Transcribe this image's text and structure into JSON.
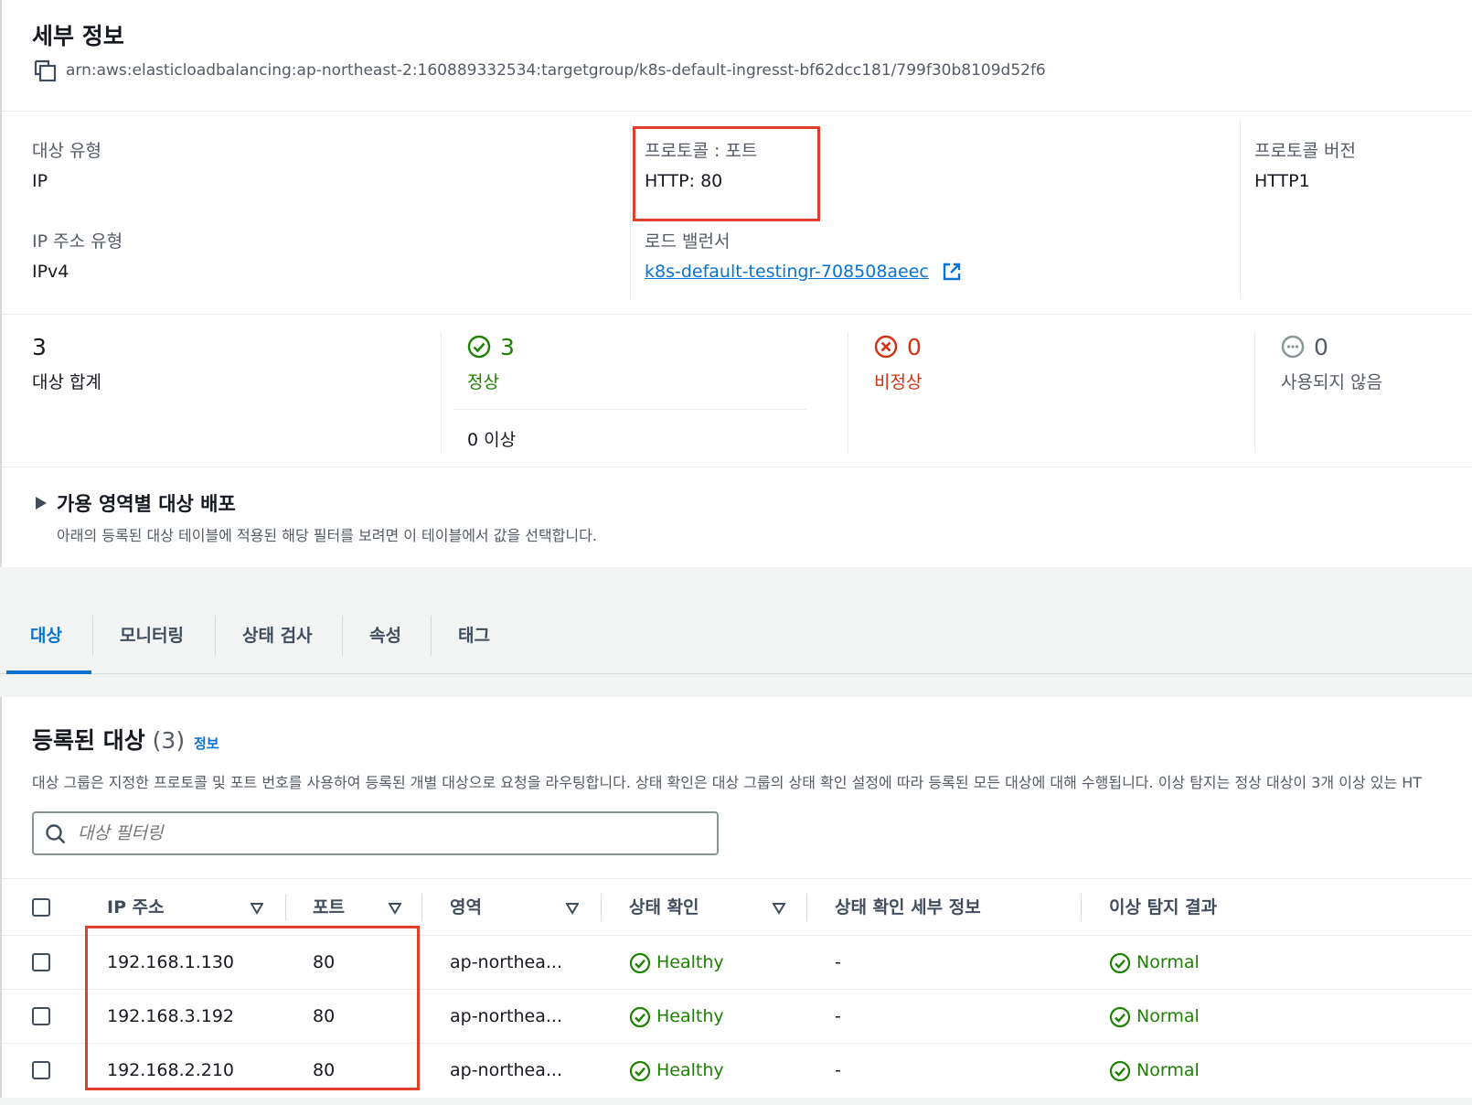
{
  "details": {
    "title": "세부 정보",
    "arn": "arn:aws:elasticloadbalancing:ap-northeast-2:160889332534:targetgroup/k8s-default-ingresst-bf62dcc181/799f30b8109d52f6",
    "target_type_label": "대상 유형",
    "target_type_value": "IP",
    "ip_type_label": "IP 주소 유형",
    "ip_type_value": "IPv4",
    "protocol_port_label": "프로토콜 : 포트",
    "protocol_port_value": "HTTP: 80",
    "load_balancer_label": "로드 밸런서",
    "load_balancer_value": "k8s-default-testingr-708508aeec",
    "protocol_version_label": "프로토콜 버전",
    "protocol_version_value": "HTTP1"
  },
  "summary": {
    "total_value": "3",
    "total_label": "대상 합계",
    "healthy_value": "3",
    "healthy_label": "정상",
    "anomaly_label": "0 이상",
    "unhealthy_value": "0",
    "unhealthy_label": "비정상",
    "unused_value": "0",
    "unused_label": "사용되지 않음"
  },
  "az": {
    "title": "가용 영역별 대상 배포",
    "desc": "아래의 등록된 대상 테이블에 적용된 해당 필터를 보려면 이 테이블에서 값을 선택합니다."
  },
  "tabs": [
    "대상",
    "모니터링",
    "상태 검사",
    "속성",
    "태그"
  ],
  "registered": {
    "title": "등록된 대상",
    "count": "(3)",
    "info": "정보",
    "desc": "대상 그룹은 지정한 프로토콜 및 포트 번호를 사용하여 등록된 개별 대상으로 요청을 라우팅합니다. 상태 확인은 대상 그룹의 상태 확인 설정에 따라 등록된 모든 대상에 대해 수행됩니다. 이상 탐지는 정상 대상이 3개 이상 있는 HT",
    "filter_placeholder": "대상 필터링"
  },
  "table": {
    "headers": [
      "IP 주소",
      "포트",
      "영역",
      "상태 확인",
      "상태 확인 세부 정보",
      "이상 탐지 결과"
    ],
    "rows": [
      {
        "ip": "192.168.1.130",
        "port": "80",
        "zone": "ap-northea...",
        "health": "Healthy",
        "details": "-",
        "anomaly": "Normal"
      },
      {
        "ip": "192.168.3.192",
        "port": "80",
        "zone": "ap-northea...",
        "health": "Healthy",
        "details": "-",
        "anomaly": "Normal"
      },
      {
        "ip": "192.168.2.210",
        "port": "80",
        "zone": "ap-northea...",
        "health": "Healthy",
        "details": "-",
        "anomaly": "Normal"
      }
    ]
  },
  "colors": {
    "healthy": "#1d8102",
    "unhealthy": "#d13212",
    "link": "#0972d3",
    "highlight_box": "#e0402a"
  }
}
